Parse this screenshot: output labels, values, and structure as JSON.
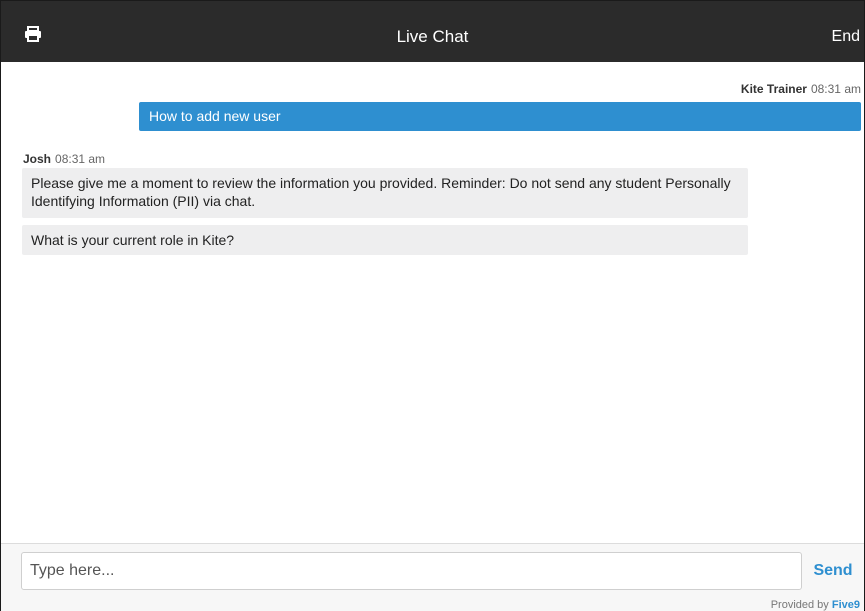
{
  "header": {
    "print_icon": "printer-icon",
    "title": "Live Chat",
    "end_label": "End"
  },
  "messages": [
    {
      "sender": "Kite Trainer",
      "time": "08:31 am",
      "text": "How to add new user",
      "side": "right"
    },
    {
      "sender": "Josh",
      "time": "08:31 am",
      "side": "left",
      "texts": [
        "Please give me a moment to review the information you provided. Reminder: Do not send any student Personally Identifying Information (PII) via chat.",
        "What is your current role in Kite?"
      ]
    }
  ],
  "composer": {
    "placeholder": "Type here...",
    "value": "",
    "send_label": "Send"
  },
  "footer": {
    "provided_by": "Provided by",
    "brand": "Five9"
  },
  "colors": {
    "header_bg": "#2b2b2b",
    "accent": "#2e8fd0",
    "bubble_gray": "#eeeeef"
  }
}
